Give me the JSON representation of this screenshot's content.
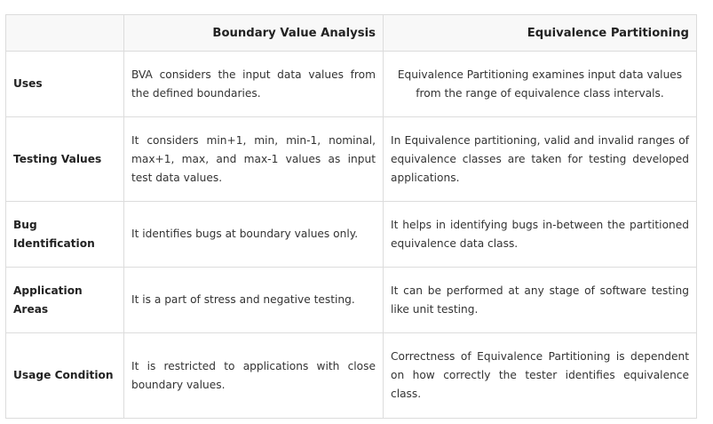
{
  "headers": {
    "corner": "",
    "col1": "Boundary Value Analysis",
    "col2": "Equivalence Partitioning"
  },
  "rows": [
    {
      "label": "Uses",
      "bva": "BVA considers the input data values from the defined boundaries.",
      "ep": "Equivalence Partitioning examines input data values from the range of equivalence class intervals."
    },
    {
      "label": "Testing Values",
      "bva": "It considers min+1, min, min-1, nominal, max+1, max, and max-1 values as input test data values.",
      "ep": "In Equivalence partitioning, valid and invalid ranges of equivalence classes are taken for testing developed applications."
    },
    {
      "label": "Bug Identification",
      "bva": "It identifies bugs at boundary values only.",
      "ep": "It helps in identifying bugs in-between the partitioned equivalence data class."
    },
    {
      "label": "Application Areas",
      "bva": "It is a part of stress and negative testing.",
      "ep": "It can be performed at any stage of software testing like unit testing."
    },
    {
      "label": "Usage Condition",
      "bva": "It is restricted to applications with close boundary values.",
      "ep": "Correctness of Equivalence Partitioning is dependent on how correctly the tester identifies equivalence class."
    }
  ]
}
